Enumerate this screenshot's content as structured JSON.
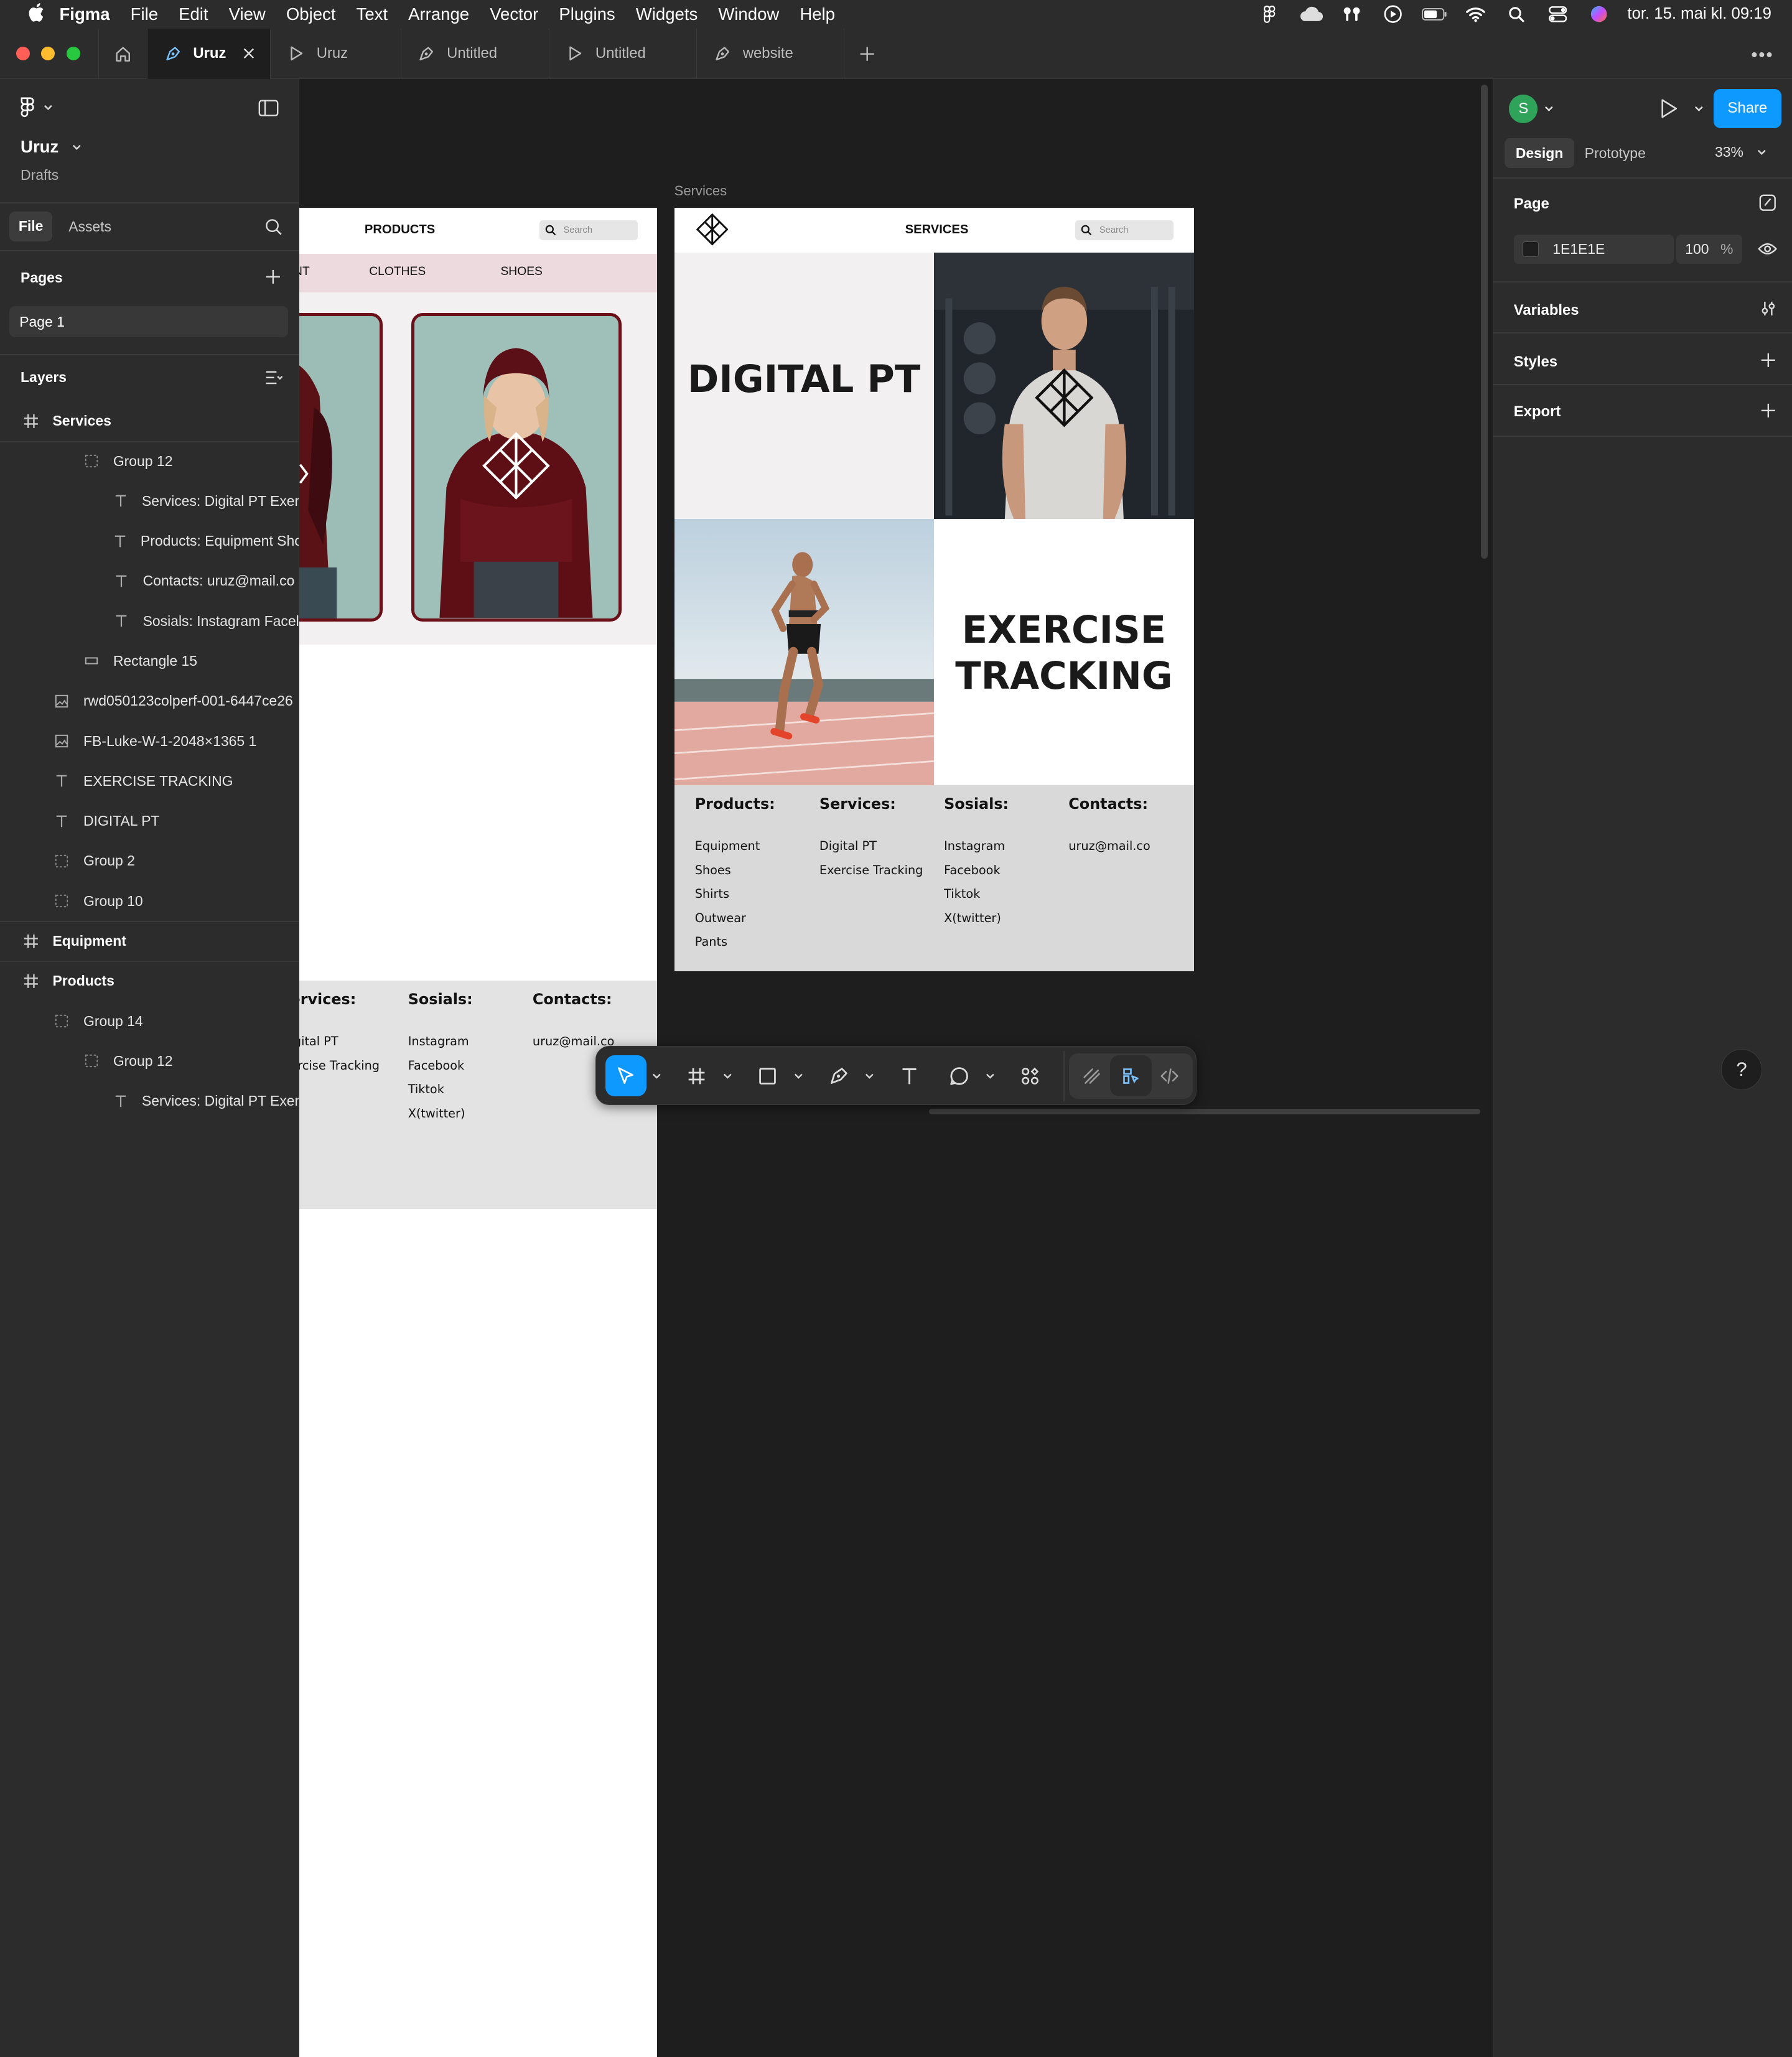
{
  "menubar": {
    "app": "Figma",
    "items": [
      "File",
      "Edit",
      "View",
      "Object",
      "Text",
      "Arrange",
      "Vector",
      "Plugins",
      "Widgets",
      "Window",
      "Help"
    ],
    "clock": "tor. 15. mai kl. 09:19"
  },
  "tabs": [
    {
      "label": "Uruz",
      "icon": "design-file-icon",
      "active": true
    },
    {
      "label": "Uruz",
      "icon": "play-icon"
    },
    {
      "label": "Untitled",
      "icon": "design-file-icon"
    },
    {
      "label": "Untitled",
      "icon": "play-icon"
    },
    {
      "label": "website",
      "icon": "design-file-icon"
    }
  ],
  "left": {
    "project": "Uruz",
    "location": "Drafts",
    "tab_file": "File",
    "tab_assets": "Assets",
    "pages_title": "Pages",
    "page": "Page 1",
    "layers_title": "Layers",
    "layers": [
      {
        "label": "Services",
        "type": "frame",
        "indent": 0
      },
      {
        "label": "Group 12",
        "type": "group",
        "indent": 2
      },
      {
        "label": "Services: Digital PT Exer",
        "type": "text",
        "indent": 3
      },
      {
        "label": "Products: Equipment Sho",
        "type": "text",
        "indent": 3
      },
      {
        "label": "Contacts: uruz@mail.co",
        "type": "text",
        "indent": 3
      },
      {
        "label": "Sosials: Instagram Facel",
        "type": "text",
        "indent": 3
      },
      {
        "label": "Rectangle 15",
        "type": "rect",
        "indent": 2
      },
      {
        "label": "rwd050123colperf-001-6447ce26",
        "type": "image",
        "indent": 1
      },
      {
        "label": "FB-Luke-W-1-2048×1365 1",
        "type": "image",
        "indent": 1
      },
      {
        "label": "EXERCISE TRACKING",
        "type": "text",
        "indent": 1
      },
      {
        "label": "DIGITAL PT",
        "type": "text",
        "indent": 1
      },
      {
        "label": "Group 2",
        "type": "group",
        "indent": 1
      },
      {
        "label": "Group 10",
        "type": "group",
        "indent": 1
      },
      {
        "label": "Equipment",
        "type": "frame",
        "indent": 0
      },
      {
        "label": "Products",
        "type": "frame",
        "indent": 0
      },
      {
        "label": "Group 14",
        "type": "group",
        "indent": 1
      },
      {
        "label": "Group 12",
        "type": "group",
        "indent": 2
      },
      {
        "label": "Services: Digital PT Exer",
        "type": "text",
        "indent": 3
      }
    ]
  },
  "canvas": {
    "frame_label": "Services",
    "products_frame": {
      "header_title": "PRODUCTS",
      "search_placeholder": "Search",
      "nav": [
        "NT",
        "CLOTHES",
        "SHOES"
      ],
      "footer_heads": [
        "ervices:",
        "Sosials:",
        "Contacts:"
      ],
      "footer_services": [
        "igital PT",
        "ercise Tracking"
      ],
      "footer_sosials": [
        "Instagram",
        "Facebook",
        "Tiktok",
        "X(twitter)"
      ],
      "footer_contacts": [
        "uruz@mail.co"
      ]
    },
    "services_frame": {
      "header_title": "SERVICES",
      "search_placeholder": "Search",
      "title1": "DIGITAL PT",
      "title2_line1": "EXERCISE",
      "title2_line2": "TRACKING",
      "footer": {
        "products_head": "Products:",
        "products": [
          "Equipment",
          "Shoes",
          "Shirts",
          "Outwear",
          "Pants"
        ],
        "services_head": "Services:",
        "services": [
          "Digital PT",
          "Exercise Tracking"
        ],
        "sosials_head": "Sosials:",
        "sosials": [
          "Instagram",
          "Facebook",
          "Tiktok",
          "X(twitter)"
        ],
        "contacts_head": "Contacts:",
        "contacts": [
          "uruz@mail.co"
        ]
      }
    }
  },
  "right": {
    "avatar_letter": "S",
    "share": "Share",
    "tab_design": "Design",
    "tab_prototype": "Prototype",
    "zoom": "33%",
    "page_title": "Page",
    "bg_hex": "1E1E1E",
    "bg_opacity": "100",
    "percent": "%",
    "variables": "Variables",
    "styles": "Styles",
    "export": "Export"
  },
  "help": "?",
  "colors": {
    "accent": "#0d99ff",
    "frame_bg": "#1e1e1e",
    "panel": "#2c2c2c",
    "hoodie": "#6b0f18",
    "avatar": "#2fa35a"
  }
}
